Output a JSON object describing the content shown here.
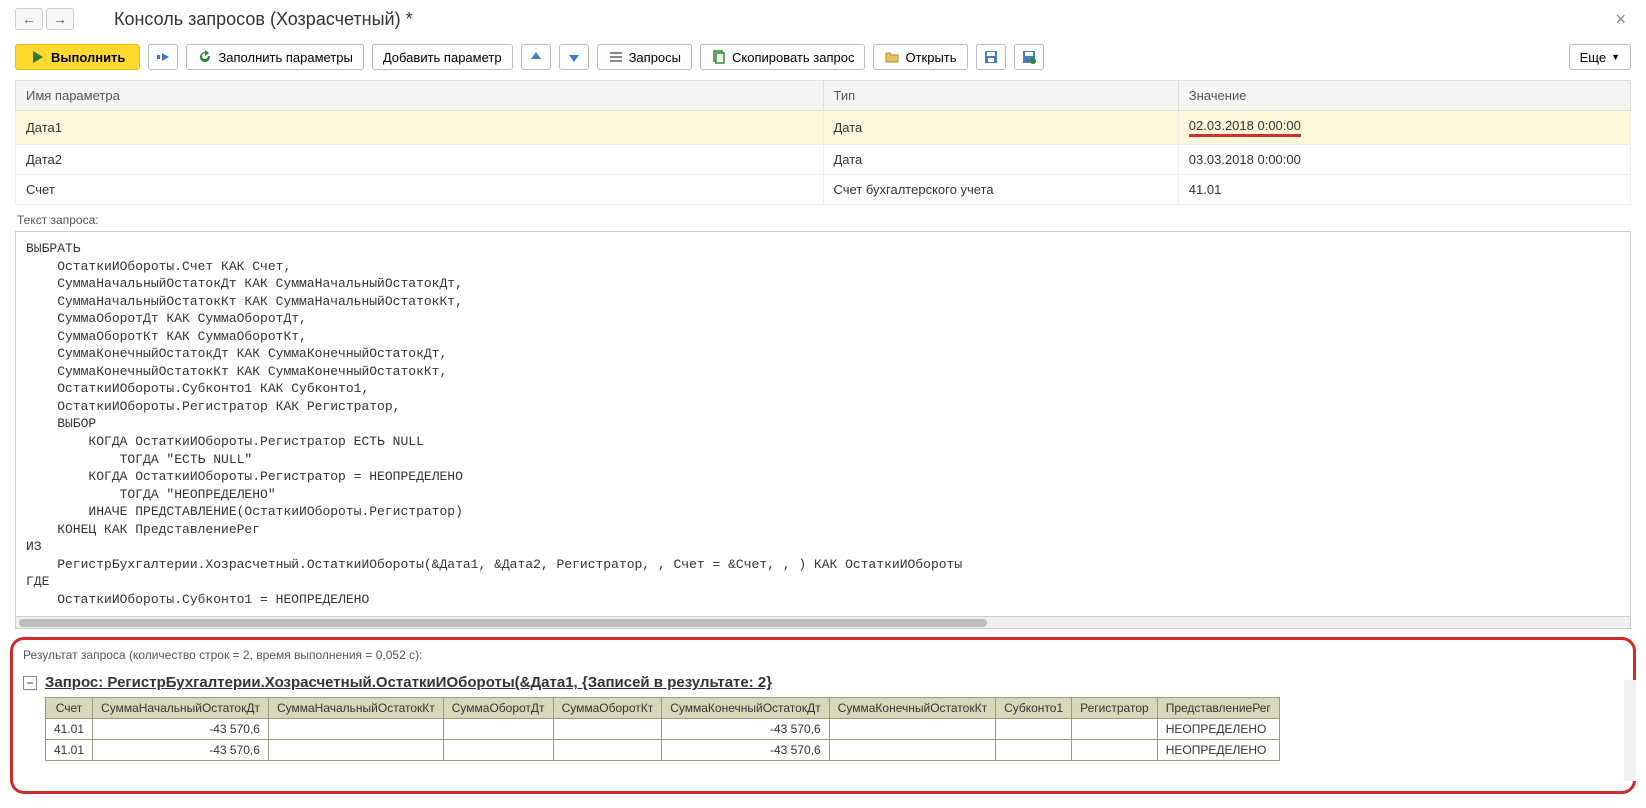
{
  "title": "Консоль запросов (Хозрасчетный) *",
  "toolbar": {
    "execute": "Выполнить",
    "fill_params": "Заполнить параметры",
    "add_param": "Добавить параметр",
    "queries": "Запросы",
    "copy_query": "Скопировать запрос",
    "open": "Открыть",
    "more": "Еще"
  },
  "params_table": {
    "headers": {
      "name": "Имя параметра",
      "type": "Тип",
      "value": "Значение"
    },
    "rows": [
      {
        "name": "Дата1",
        "type": "Дата",
        "value": "02.03.2018 0:00:00",
        "selected": true,
        "highlight_value": true
      },
      {
        "name": "Дата2",
        "type": "Дата",
        "value": "03.03.2018 0:00:00"
      },
      {
        "name": "Счет",
        "type": "Счет бухгалтерского учета",
        "value": "41.01"
      }
    ]
  },
  "query_label": "Текст запроса:",
  "query_text": "ВЫБРАТЬ\n    ОстаткиИОбороты.Счет КАК Счет,\n    СуммаНачальныйОстатокДт КАК СуммаНачальныйОстатокДт,\n    СуммаНачальныйОстатокКт КАК СуммаНачальныйОстатокКт,\n    СуммаОборотДт КАК СуммаОборотДт,\n    СуммаОборотКт КАК СуммаОборотКт,\n    СуммаКонечныйОстатокДт КАК СуммаКонечныйОстатокДт,\n    СуммаКонечныйОстатокКт КАК СуммаКонечныйОстатокКт,\n    ОстаткиИОбороты.Субконто1 КАК Субконто1,\n    ОстаткиИОбороты.Регистратор КАК Регистратор,\n    ВЫБОР\n        КОГДА ОстаткиИОбороты.Регистратор ЕСТЬ NULL\n            ТОГДА \"ЕСТЬ NULL\"\n        КОГДА ОстаткиИОбороты.Регистратор = НЕОПРЕДЕЛЕНО\n            ТОГДА \"НЕОПРЕДЕЛЕНО\"\n        ИНАЧЕ ПРЕДСТАВЛЕНИЕ(ОстаткиИОбороты.Регистратор)\n    КОНЕЦ КАК ПредставлениеРег\nИЗ\n    РегистрБухгалтерии.Хозрасчетный.ОстаткиИОбороты(&Дата1, &Дата2, Регистратор, , Счет = &Счет, , ) КАК ОстаткиИОбороты\nГДЕ\n    ОстаткиИОбороты.Субконто1 = НЕОПРЕДЕЛЕНО",
  "results": {
    "label": "Результат запроса (количество строк = 2, время выполнения = 0,052 с):",
    "heading": "Запрос: РегистрБухгалтерии.Хозрасчетный.ОстаткиИОбороты(&Дата1, {Записей в результате: 2}",
    "columns": [
      "Счет",
      "СуммаНачальныйОстатокДт",
      "СуммаНачальныйОстатокКт",
      "СуммаОборотДт",
      "СуммаОборотКт",
      "СуммаКонечныйОстатокДт",
      "СуммаКонечныйОстатокКт",
      "Субконто1",
      "Регистратор",
      "ПредставлениеРег"
    ],
    "rows": [
      {
        "Счет": "41.01",
        "СуммаНачальныйОстатокДт": "-43 570,6",
        "СуммаКонечныйОстатокДт": "-43 570,6",
        "ПредставлениеРег": "НЕОПРЕДЕЛЕНО"
      },
      {
        "Счет": "41.01",
        "СуммаНачальныйОстатокДт": "-43 570,6",
        "СуммаКонечныйОстатокДт": "-43 570,6",
        "ПредставлениеРег": "НЕОПРЕДЕЛЕНО"
      }
    ]
  }
}
